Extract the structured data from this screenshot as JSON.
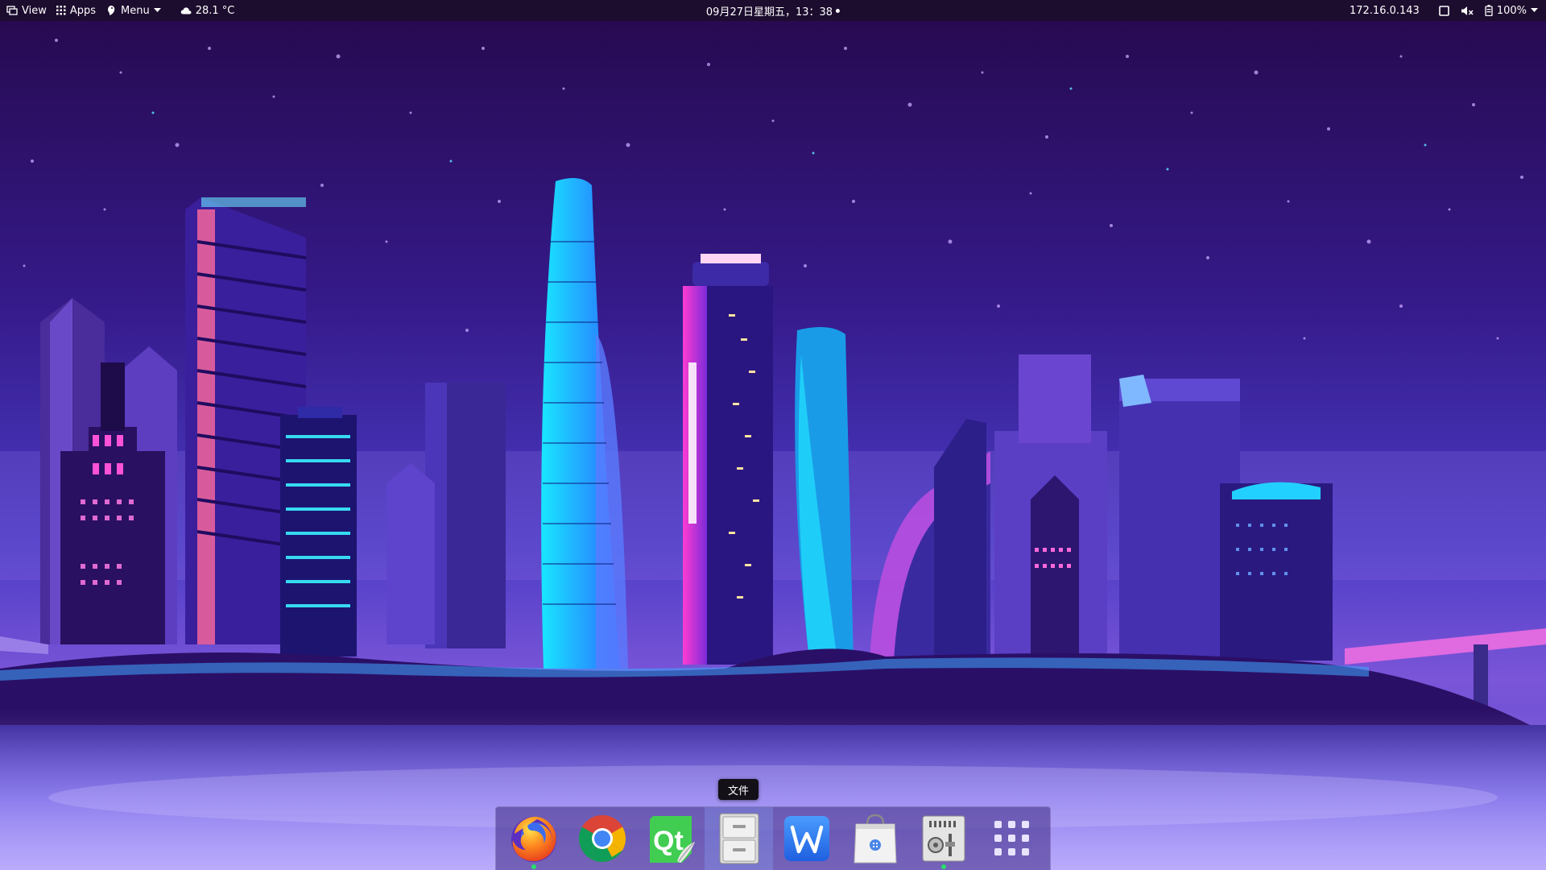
{
  "top_panel": {
    "view_label": "View",
    "apps_label": "Apps",
    "menu_label": "Menu",
    "weather_text": "28.1 °C",
    "datetime": "09月27日星期五，13：38",
    "ip_address": "172.16.0.143",
    "battery_text": "100%",
    "icons": [
      "view-icon",
      "apps-grid-icon",
      "menu-icon",
      "cloud-icon",
      "window-icon",
      "volume-muted-icon",
      "battery-icon",
      "chevron-down-icon"
    ]
  },
  "dock": {
    "tooltip": "文件",
    "items": [
      {
        "name": "firefox",
        "icon": "firefox-icon",
        "running": true
      },
      {
        "name": "chrome",
        "icon": "chrome-icon",
        "running": false
      },
      {
        "name": "qt-creator",
        "icon": "qt-icon",
        "running": false
      },
      {
        "name": "file-manager",
        "icon": "file-cabinet-icon",
        "running": false,
        "hovered": true
      },
      {
        "name": "wps-writer",
        "icon": "wps-icon",
        "running": false
      },
      {
        "name": "software-store",
        "icon": "shopping-bag-icon",
        "running": false
      },
      {
        "name": "system-settings",
        "icon": "settings-panel-icon",
        "running": true
      },
      {
        "name": "app-launcher",
        "icon": "app-grid-icon",
        "running": false
      }
    ],
    "qt_label": "Qt"
  },
  "colors": {
    "panel_bg": "#1c0c2e",
    "sky_top": "#2a0e57",
    "sky_mid": "#3b1f9a",
    "water": "#3a2ca8",
    "accent_cyan": "#22e0ff",
    "accent_pink": "#ff3cc8",
    "running_indicator": "#27e06a"
  }
}
